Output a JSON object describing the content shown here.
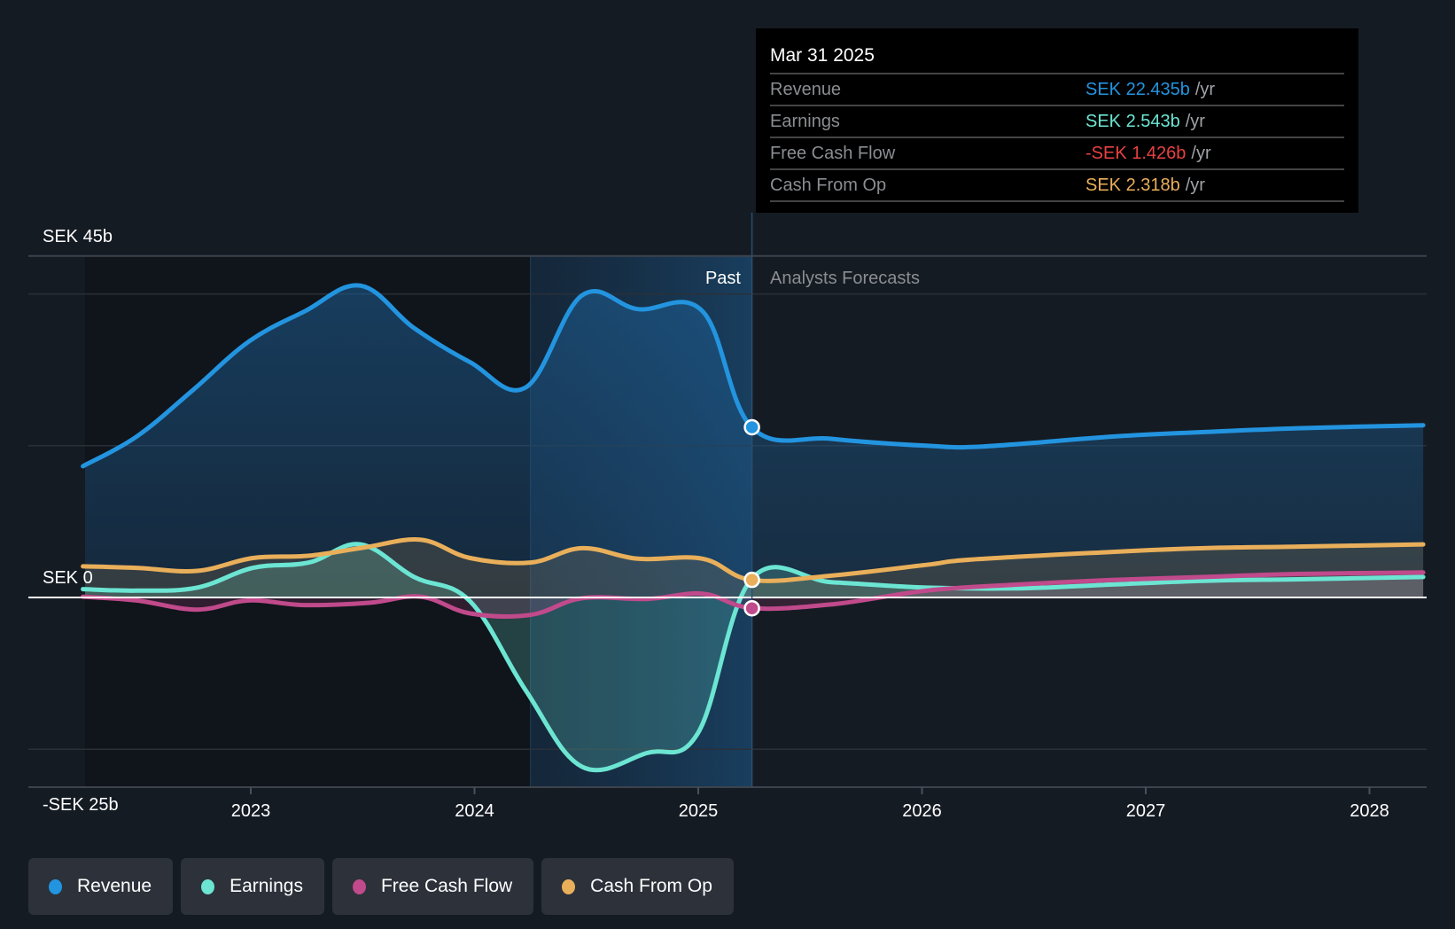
{
  "tooltip": {
    "date": "Mar 31 2025",
    "rows": [
      {
        "name": "Revenue",
        "value": "SEK 22.435b",
        "unit": "/yr",
        "color": "#2394df"
      },
      {
        "name": "Earnings",
        "value": "SEK 2.543b",
        "unit": "/yr",
        "color": "#6ce5d3"
      },
      {
        "name": "Free Cash Flow",
        "value": "-SEK 1.426b",
        "unit": "/yr",
        "color": "#e84142"
      },
      {
        "name": "Cash From Op",
        "value": "SEK 2.318b",
        "unit": "/yr",
        "color": "#e9af5a"
      }
    ]
  },
  "legend": [
    {
      "label": "Revenue",
      "color": "#2394df"
    },
    {
      "label": "Earnings",
      "color": "#6ce5d3"
    },
    {
      "label": "Free Cash Flow",
      "color": "#c04a8b"
    },
    {
      "label": "Cash From Op",
      "color": "#e9af5a"
    }
  ],
  "chart_data": {
    "type": "line",
    "title": "",
    "currency": "SEK",
    "y_unit": "billions",
    "ylim": [
      -25,
      45
    ],
    "xlim": [
      2021.76,
      2028.24
    ],
    "y_tick_labels": [
      {
        "value": 45,
        "label": "SEK 45b"
      },
      {
        "value": 0,
        "label": "SEK 0"
      },
      {
        "value": -25,
        "label": "-SEK 25b"
      }
    ],
    "gridlines": [
      45,
      40,
      20,
      0,
      -20,
      -25
    ],
    "x_ticks": [
      {
        "value": 2023,
        "label": "2023"
      },
      {
        "value": 2024,
        "label": "2024"
      },
      {
        "value": 2025,
        "label": "2025"
      },
      {
        "value": 2026,
        "label": "2026"
      },
      {
        "value": 2027,
        "label": "2027"
      },
      {
        "value": 2028,
        "label": "2028"
      }
    ],
    "divider_x": 2025.24,
    "highlight_start_x": 2024.25,
    "region_labels": {
      "past": "Past",
      "forecast": "Analysts Forecasts"
    },
    "series": [
      {
        "name": "Revenue",
        "color": "#2394df",
        "points": [
          [
            2022.25,
            17.3
          ],
          [
            2022.49,
            21.2
          ],
          [
            2022.74,
            27.3
          ],
          [
            2022.99,
            33.7
          ],
          [
            2023.24,
            37.7
          ],
          [
            2023.49,
            41.1
          ],
          [
            2023.73,
            35.5
          ],
          [
            2023.98,
            31.0
          ],
          [
            2024.23,
            27.7
          ],
          [
            2024.48,
            39.8
          ],
          [
            2024.73,
            38.0
          ],
          [
            2025.02,
            37.7
          ],
          [
            2025.24,
            22.4
          ],
          [
            2025.6,
            20.9
          ],
          [
            2026.02,
            20.0
          ],
          [
            2026.27,
            19.9
          ],
          [
            2026.85,
            21.2
          ],
          [
            2027.26,
            21.8
          ],
          [
            2027.68,
            22.3
          ],
          [
            2028.24,
            22.7
          ]
        ]
      },
      {
        "name": "Earnings",
        "color": "#6ce5d3",
        "points": [
          [
            2022.25,
            1.1
          ],
          [
            2022.49,
            0.9
          ],
          [
            2022.76,
            1.3
          ],
          [
            2023.01,
            3.9
          ],
          [
            2023.26,
            4.6
          ],
          [
            2023.49,
            7.0
          ],
          [
            2023.73,
            2.7
          ],
          [
            2023.98,
            -0.5
          ],
          [
            2024.23,
            -12.3
          ],
          [
            2024.48,
            -22.3
          ],
          [
            2024.77,
            -20.5
          ],
          [
            2025.0,
            -17.8
          ],
          [
            2025.24,
            2.5
          ],
          [
            2025.6,
            2.0
          ],
          [
            2026.02,
            1.3
          ],
          [
            2026.43,
            1.2
          ],
          [
            2026.85,
            1.7
          ],
          [
            2027.26,
            2.2
          ],
          [
            2027.68,
            2.4
          ],
          [
            2028.24,
            2.7
          ]
        ]
      },
      {
        "name": "Free Cash Flow",
        "color": "#c04a8b",
        "points": [
          [
            2022.25,
            0.1
          ],
          [
            2022.49,
            -0.4
          ],
          [
            2022.76,
            -1.6
          ],
          [
            2022.99,
            -0.4
          ],
          [
            2023.24,
            -1.0
          ],
          [
            2023.53,
            -0.7
          ],
          [
            2023.76,
            0.1
          ],
          [
            2023.98,
            -2.1
          ],
          [
            2024.25,
            -2.3
          ],
          [
            2024.48,
            -0.1
          ],
          [
            2024.77,
            -0.2
          ],
          [
            2025.02,
            0.5
          ],
          [
            2025.24,
            -1.4
          ],
          [
            2025.6,
            -0.9
          ],
          [
            2026.02,
            0.9
          ],
          [
            2026.43,
            1.7
          ],
          [
            2026.85,
            2.3
          ],
          [
            2027.26,
            2.7
          ],
          [
            2027.68,
            3.1
          ],
          [
            2028.24,
            3.3
          ]
        ]
      },
      {
        "name": "Cash From Op",
        "color": "#e9af5a",
        "points": [
          [
            2022.25,
            4.1
          ],
          [
            2022.49,
            3.9
          ],
          [
            2022.76,
            3.5
          ],
          [
            2023.01,
            5.2
          ],
          [
            2023.26,
            5.5
          ],
          [
            2023.51,
            6.6
          ],
          [
            2023.76,
            7.6
          ],
          [
            2023.98,
            5.2
          ],
          [
            2024.25,
            4.6
          ],
          [
            2024.48,
            6.5
          ],
          [
            2024.73,
            5.1
          ],
          [
            2025.02,
            5.1
          ],
          [
            2025.24,
            2.3
          ],
          [
            2025.6,
            2.9
          ],
          [
            2026.02,
            4.3
          ],
          [
            2026.22,
            5.0
          ],
          [
            2026.85,
            6.0
          ],
          [
            2027.26,
            6.5
          ],
          [
            2027.68,
            6.7
          ],
          [
            2028.24,
            7.0
          ]
        ]
      }
    ],
    "highlighted_points": [
      {
        "series": "Revenue",
        "x": 2025.24,
        "y": 22.435
      },
      {
        "series": "Cash From Op",
        "x": 2025.24,
        "y": 2.318
      },
      {
        "series": "Free Cash Flow",
        "x": 2025.24,
        "y": -1.426
      }
    ]
  }
}
